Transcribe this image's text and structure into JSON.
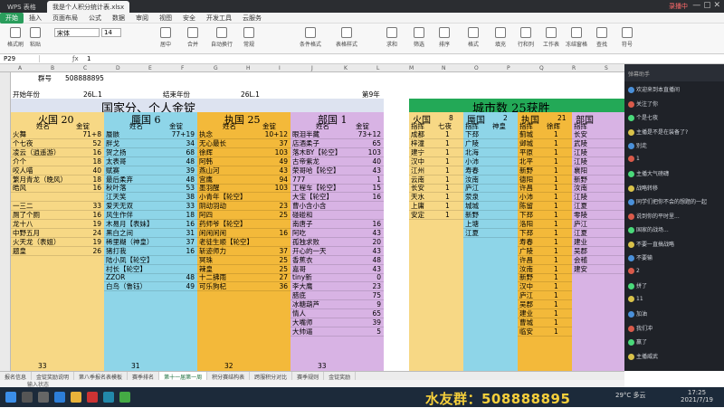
{
  "window": {
    "tabs": [
      "WPS 表格",
      "我是个人积分统计表.xlsx"
    ],
    "right_status": "录播中"
  },
  "menu": [
    "开始",
    "插入",
    "页面布局",
    "公式",
    "数据",
    "审阅",
    "视图",
    "安全",
    "开发工具",
    "云服务"
  ],
  "ribbon": [
    "格式刷",
    "粘贴",
    "字体",
    "居中",
    "合并",
    "自动换行",
    "常规",
    "条件格式",
    "表格样式",
    "求和",
    "筛选",
    "排序",
    "格式",
    "填充",
    "行和列",
    "工作表",
    "冻结窗格",
    "查找",
    "符号"
  ],
  "font_name": "宋体",
  "font_size": "14",
  "cell_ref": "P29",
  "formula_value": "1",
  "top_rows": {
    "group_label": "群号",
    "group_no": "508888895",
    "start_label": "开始年份",
    "start_val": "26L.1",
    "end_label": "结束年份",
    "end_val": "26L.1",
    "extra": "第9年"
  },
  "main_title": "国家分、个人金锭",
  "city_title": "城市数 25获胜",
  "teams": [
    {
      "name": "火国 20",
      "col1": "姓名",
      "col2": "金锭",
      "total": "33",
      "rows": [
        [
          "火舞",
          "71+8"
        ],
        [
          "个七夜",
          "52"
        ],
        [
          "凌云（逍遥游）",
          "16"
        ],
        [
          "介个",
          "18"
        ],
        [
          "咬人喵",
          "40"
        ],
        [
          "繁月青龙（晚风）",
          "18"
        ],
        [
          "皓风",
          "16"
        ],
        [
          "",
          ""
        ],
        [
          "一三二",
          "33"
        ],
        [
          "厕了个厕",
          "16"
        ],
        [
          "龙十八",
          "19"
        ],
        [
          "中野五月",
          "24"
        ],
        [
          "火天龙（表姐）",
          "19"
        ],
        [
          "题皇",
          "26"
        ]
      ]
    },
    {
      "name": "蜃国 6",
      "col1": "姓名",
      "col2": "金锭",
      "total": "31",
      "rows": [
        [
          "蜃骸",
          "77+19"
        ],
        [
          "胖戈",
          "34"
        ],
        [
          "贺之扬",
          "68"
        ],
        [
          "太表哥",
          "48"
        ],
        [
          "赋赛",
          "39"
        ],
        [
          "最后柔弃",
          "48"
        ],
        [
          "秋叶落",
          "53"
        ],
        [
          "江天笑",
          "38"
        ],
        [
          "爱天无双",
          "33"
        ],
        [
          "风生作伴",
          "18"
        ],
        [
          "木易月【表妹】",
          "16"
        ],
        [
          "黑白之间",
          "31"
        ],
        [
          "稀里糊（神皇）",
          "37"
        ],
        [
          "猪打我",
          "16"
        ],
        [
          "陆小凤【轮空】",
          ""
        ],
        [
          "村长【轮空】",
          ""
        ],
        [
          "ZZOR",
          "48"
        ],
        [
          "白鸟（鲁钰）",
          "49"
        ]
      ]
    },
    {
      "name": "执国 25",
      "col1": "姓名",
      "col2": "金锭",
      "total": "32",
      "rows": [
        [
          "执念",
          "10+12"
        ],
        [
          "无心最长",
          "37"
        ],
        [
          "徐辉",
          "103"
        ],
        [
          "阿韩",
          "49"
        ],
        [
          "燕山河",
          "43"
        ],
        [
          "宫鹰",
          "94"
        ],
        [
          "墨羽醒",
          "103"
        ],
        [
          "小青年【轮空】",
          ""
        ],
        [
          "阴动羽动",
          "23"
        ],
        [
          "阿四",
          "25"
        ],
        [
          "药师爷【轮空】",
          ""
        ],
        [
          "闲闲闲闲",
          "16"
        ],
        [
          "老徒生顺【轮空】",
          ""
        ],
        [
          "斩迹师力",
          "37"
        ],
        [
          "冥珠",
          "25"
        ],
        [
          "辣皇",
          "25"
        ],
        [
          "十二拂雨",
          "27"
        ],
        [
          "可乐狗杞",
          "36"
        ]
      ]
    },
    {
      "name": "部国 1",
      "col1": "姓名",
      "col2": "金锭",
      "total": "33",
      "rows": [
        [
          "眼泪半藏",
          "73+12"
        ],
        [
          "店酒柔子",
          "65"
        ],
        [
          "落木BY【轮空】",
          "103"
        ],
        [
          "古帝紫龙",
          "40"
        ],
        [
          "荣哥哈【轮空】",
          "43"
        ],
        [
          "777",
          "1"
        ],
        [
          "工程车【轮空】",
          "15"
        ],
        [
          "大宝【轮空】",
          "16"
        ],
        [
          "曹小含小含",
          ""
        ],
        [
          "碰碰和",
          ""
        ],
        [
          "南唐子",
          "16"
        ],
        [
          "阿吃",
          "43"
        ],
        [
          "孤独求败",
          "20"
        ],
        [
          "开心的一天",
          "43"
        ],
        [
          "香蕉衣",
          "48"
        ],
        [
          "嘉哥",
          "43"
        ],
        [
          "tiny新",
          "0"
        ],
        [
          "李大鹰",
          "23"
        ],
        [
          "腊底",
          "75"
        ],
        [
          "冰糖葫芦",
          "9"
        ],
        [
          "情人",
          "65"
        ],
        [
          "大嘴师",
          "39"
        ],
        [
          "大帅逼",
          "5"
        ]
      ]
    }
  ],
  "city_cols": [
    {
      "name": "火国",
      "count": "8",
      "h1": "指挥",
      "h2": "七夜",
      "rows": [
        [
          "成都",
          "1"
        ],
        [
          "梓潼",
          "1"
        ],
        [
          "建宁",
          "1"
        ],
        [
          "汉中",
          "1"
        ],
        [
          "江州",
          "1"
        ],
        [
          "云南",
          "1"
        ],
        [
          "长安",
          "1"
        ],
        [
          "天水",
          "1"
        ],
        [
          "上庸",
          "1"
        ],
        [
          "安定",
          "1"
        ]
      ]
    },
    {
      "name": "蜃国",
      "count": "2",
      "h1": "指挥",
      "h2": "神皇",
      "rows": [
        [
          "下邳",
          ""
        ],
        [
          "广陵",
          ""
        ],
        [
          "北海",
          ""
        ],
        [
          "小沛",
          ""
        ],
        [
          "寿春",
          ""
        ],
        [
          "汝南",
          ""
        ],
        [
          "庐江",
          ""
        ],
        [
          "荥泉",
          ""
        ],
        [
          "城城",
          ""
        ],
        [
          "新野",
          ""
        ],
        [
          "上塘",
          ""
        ],
        [
          "江夏",
          ""
        ]
      ]
    },
    {
      "name": "执国",
      "count": "21",
      "h1": "指挥",
      "h2": "徐辉",
      "rows": [
        [
          "蓟城",
          "1"
        ],
        [
          "邺城",
          "1"
        ],
        [
          "平原",
          "1"
        ],
        [
          "北平",
          "1"
        ],
        [
          "新野",
          "1"
        ],
        [
          "德阳",
          "1"
        ],
        [
          "许昌",
          "1"
        ],
        [
          "小沛",
          "1"
        ],
        [
          "陈留",
          "1"
        ],
        [
          "下邳",
          "1"
        ],
        [
          "洛阳",
          "1"
        ],
        [
          "下邳",
          "1"
        ],
        [
          "寿春",
          "1"
        ],
        [
          "广陵",
          "1"
        ],
        [
          "许昌",
          "1"
        ],
        [
          "汝南",
          "1"
        ],
        [
          "新野",
          "1"
        ],
        [
          "汉中",
          "1"
        ],
        [
          "庐江",
          "1"
        ],
        [
          "吴郡",
          "1"
        ],
        [
          "建业",
          "1"
        ],
        [
          "曹城",
          "1"
        ],
        [
          "临安",
          "1"
        ]
      ]
    },
    {
      "name": "部国",
      "count": "",
      "h1": "指挥",
      "h2": "",
      "rows": [
        [
          "长安",
          ""
        ],
        [
          "武陵",
          ""
        ],
        [
          "江陵",
          ""
        ],
        [
          "江陵",
          ""
        ],
        [
          "襄阳",
          ""
        ],
        [
          "新野",
          ""
        ],
        [
          "汝南",
          ""
        ],
        [
          "江陵",
          ""
        ],
        [
          "江夏",
          ""
        ],
        [
          "零陵",
          ""
        ],
        [
          "庐江",
          ""
        ],
        [
          "江夏",
          ""
        ],
        [
          "建业",
          ""
        ],
        [
          "吴郡",
          ""
        ],
        [
          "会稽",
          ""
        ],
        [
          "建安",
          ""
        ]
      ]
    }
  ],
  "sheet_tabs": [
    "报名信息",
    "金锭奖励说明",
    "第八季报名表模板",
    "赛季排名",
    "第十一届第一周",
    "积分赛结构表",
    "跨服积分对比",
    "赛季规则",
    "金锭奖励"
  ],
  "status_left": "输入状态",
  "taskbar_qq": "水友群：508888895",
  "clock_time": "17:25",
  "clock_date": "2021/7/19",
  "weather": "29°C 多云",
  "chat_header": "弹幕助手",
  "chat": [
    "欢迎来到本直播间",
    "关注了你",
    "个是七夜",
    "主播是不是在装备了?",
    "别走",
    "1",
    "主播大气磅礴",
    "战略转移",
    "同学们把你不会的想题的一起",
    "说到你的平时里...",
    "国家的战场...",
    "不要一直搞战略",
    "不要输",
    "2",
    "拼了",
    "11",
    "加油",
    "我们冲",
    "赢了",
    "主播威武"
  ]
}
